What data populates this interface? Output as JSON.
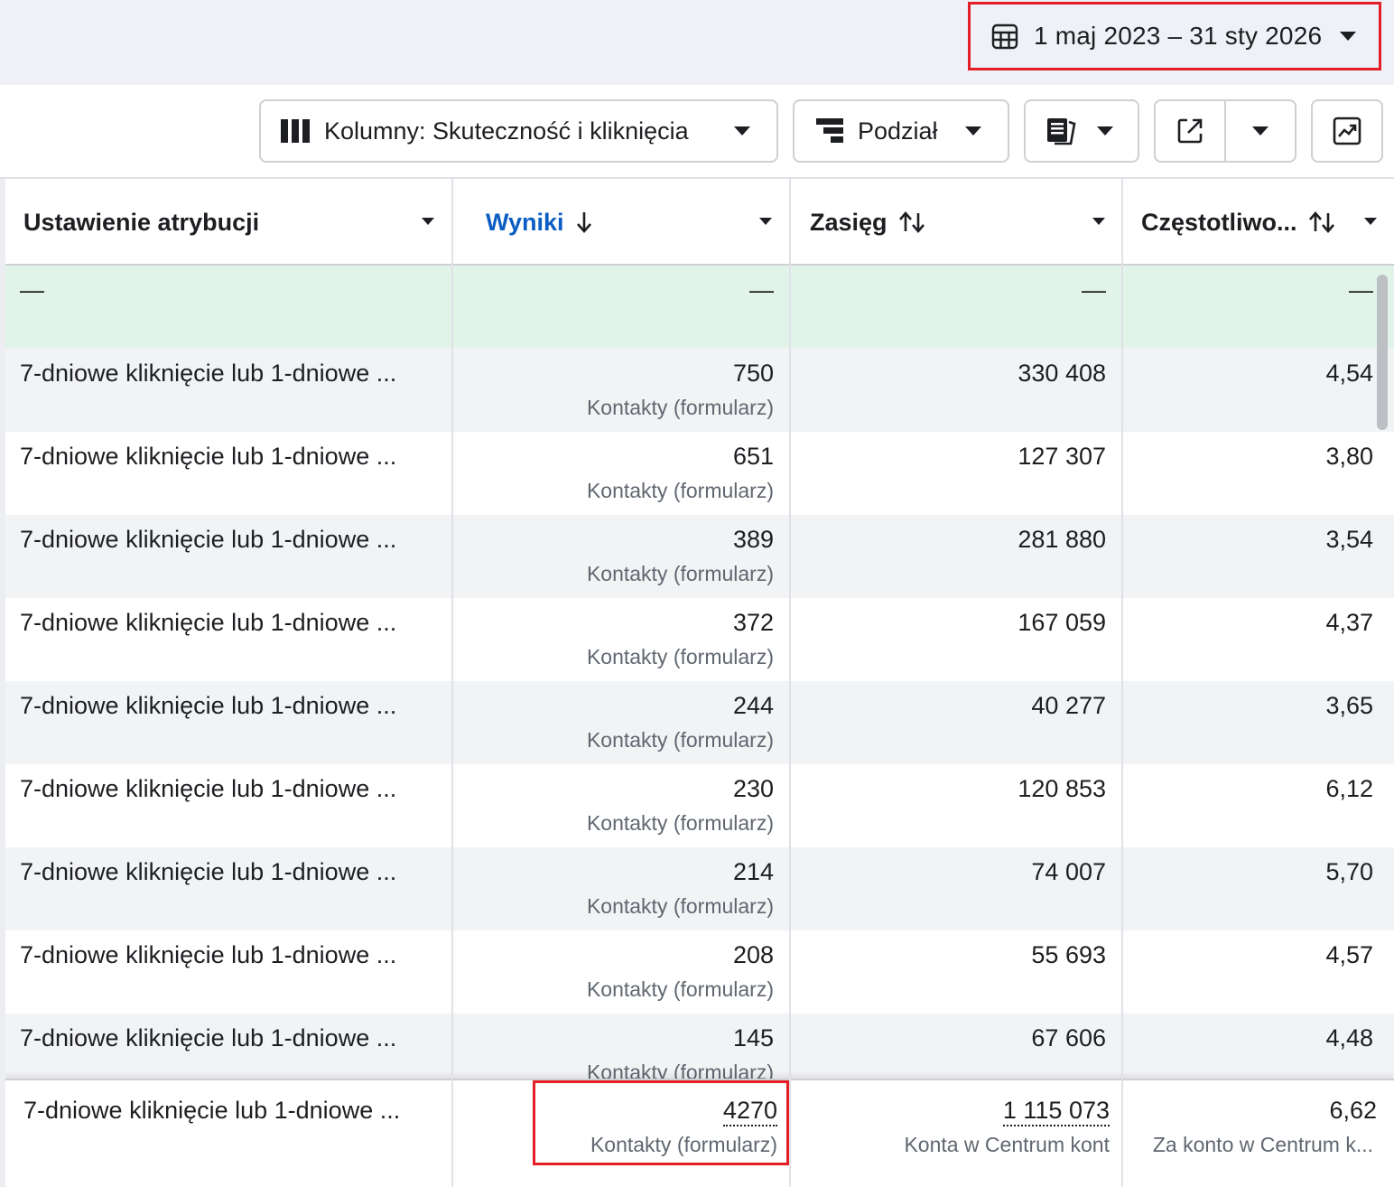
{
  "date_range": {
    "label": "1 maj 2023 – 31 sty 2026"
  },
  "toolbar": {
    "columns_label": "Kolumny: Skuteczność i kliknięcia",
    "breakdown_label": "Podział"
  },
  "table": {
    "headers": {
      "attribution": "Ustawienie atrybucji",
      "results": "Wyniki",
      "reach": "Zasięg",
      "frequency": "Częstotliwo..."
    },
    "summary_row": {
      "dash": "—"
    },
    "rows": [
      {
        "attribution": "7-dniowe kliknięcie lub 1-dniowe ...",
        "results": "750",
        "results_type": "Kontakty (formularz)",
        "reach": "330 408",
        "frequency": "4,54"
      },
      {
        "attribution": "7-dniowe kliknięcie lub 1-dniowe ...",
        "results": "651",
        "results_type": "Kontakty (formularz)",
        "reach": "127 307",
        "frequency": "3,80"
      },
      {
        "attribution": "7-dniowe kliknięcie lub 1-dniowe ...",
        "results": "389",
        "results_type": "Kontakty (formularz)",
        "reach": "281 880",
        "frequency": "3,54"
      },
      {
        "attribution": "7-dniowe kliknięcie lub 1-dniowe ...",
        "results": "372",
        "results_type": "Kontakty (formularz)",
        "reach": "167 059",
        "frequency": "4,37"
      },
      {
        "attribution": "7-dniowe kliknięcie lub 1-dniowe ...",
        "results": "244",
        "results_type": "Kontakty (formularz)",
        "reach": "40 277",
        "frequency": "3,65"
      },
      {
        "attribution": "7-dniowe kliknięcie lub 1-dniowe ...",
        "results": "230",
        "results_type": "Kontakty (formularz)",
        "reach": "120 853",
        "frequency": "6,12"
      },
      {
        "attribution": "7-dniowe kliknięcie lub 1-dniowe ...",
        "results": "214",
        "results_type": "Kontakty (formularz)",
        "reach": "74 007",
        "frequency": "5,70"
      },
      {
        "attribution": "7-dniowe kliknięcie lub 1-dniowe ...",
        "results": "208",
        "results_type": "Kontakty (formularz)",
        "reach": "55 693",
        "frequency": "4,57"
      },
      {
        "attribution": "7-dniowe kliknięcie lub 1-dniowe ...",
        "results": "145",
        "results_type": "Kontakty (formularz)",
        "reach": "67 606",
        "frequency": "4,48"
      }
    ],
    "totals": {
      "attribution": "7-dniowe kliknięcie lub 1-dniowe ...",
      "results": "4270",
      "results_type": "Kontakty (formularz)",
      "reach": "1 115 073",
      "reach_type": "Konta w Centrum kont",
      "frequency": "6,62",
      "frequency_type": "Za konto w Centrum k..."
    }
  },
  "colors": {
    "highlight": "#e41e26",
    "active_header": "#0a5dc2",
    "summary_row": "#e2f3ea"
  },
  "icons": [
    "calendar-icon",
    "chevron-down-icon",
    "columns-icon",
    "breakdown-icon",
    "reports-icon",
    "export-icon",
    "chart-icon",
    "sort-down-icon",
    "sort-both-icon"
  ]
}
